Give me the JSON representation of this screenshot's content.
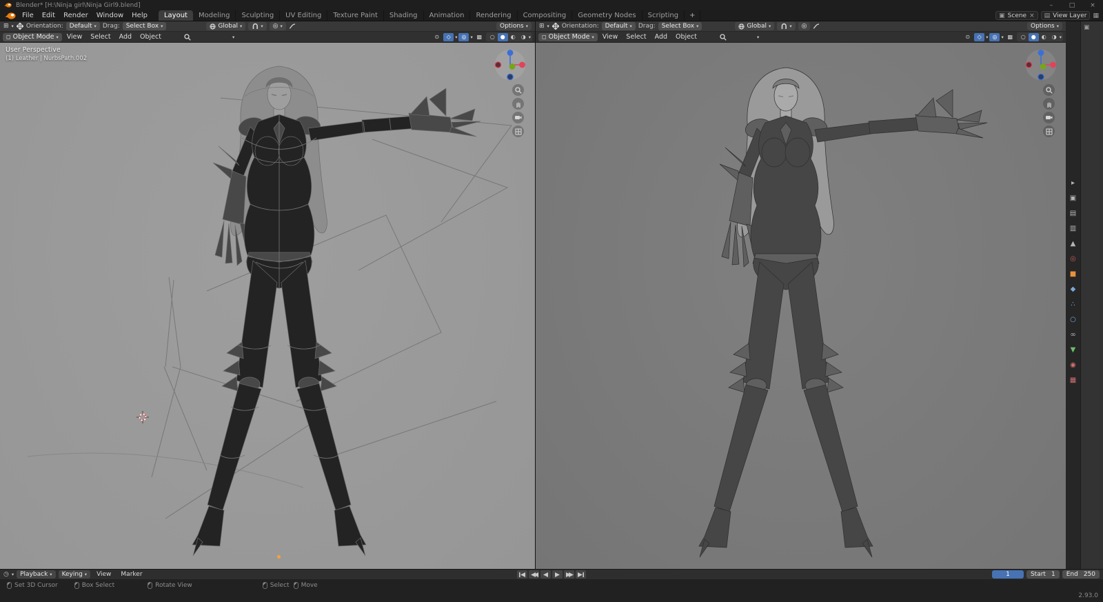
{
  "window": {
    "title": "Blender* [H:\\Ninja girl\\Ninja Girl9.blend]",
    "minimize": "–",
    "maximize": "□",
    "close": "×"
  },
  "topbar": {
    "menus": [
      "File",
      "Edit",
      "Render",
      "Window",
      "Help"
    ],
    "workspaces": [
      "Layout",
      "Modeling",
      "Sculpting",
      "UV Editing",
      "Texture Paint",
      "Shading",
      "Animation",
      "Rendering",
      "Compositing",
      "Geometry Nodes",
      "Scripting"
    ],
    "active_workspace": "Layout",
    "new_workspace": "+",
    "scene": "Scene",
    "view_layer": "View Layer"
  },
  "icons": {
    "caret": "▾",
    "close": "×",
    "visibility": "⊙",
    "gizmo": "◇",
    "overlay": "◎",
    "xray": "▩",
    "wireframe": "○",
    "solid": "●",
    "material": "◐",
    "rendered": "◑",
    "editor_3d": "⊞",
    "editor_time": "◷",
    "scene_icon": "▣",
    "view_layer_icon": "▤",
    "image_icon": "▦"
  },
  "viewport": {
    "left": {
      "tool": {
        "orientation_label": "Orientation:",
        "orientation": "Default",
        "drag_label": "Drag:",
        "drag": "Select Box",
        "transform": "Global",
        "options": "Options"
      },
      "header": {
        "mode": "Object Mode",
        "view": "View",
        "select": "Select",
        "add": "Add",
        "object": "Object"
      },
      "overlay": {
        "perspective": "User Perspective",
        "active_object": "(1) Leather | NurbsPath.002"
      }
    },
    "right": {
      "tool": {
        "orientation_label": "Orientation:",
        "orientation": "Default",
        "drag_label": "Drag:",
        "drag": "Select Box",
        "transform": "Global",
        "options": "Options"
      },
      "header": {
        "mode": "Object Mode",
        "view": "View",
        "select": "Select",
        "add": "Add",
        "object": "Object"
      }
    }
  },
  "rail": {
    "items": [
      {
        "name": "tool",
        "glyph": "▸",
        "color": "#b4b4b4"
      },
      {
        "name": "render",
        "glyph": "▣",
        "color": "#b4b4b4"
      },
      {
        "name": "output",
        "glyph": "▤",
        "color": "#b4b4b4"
      },
      {
        "name": "view-layer",
        "glyph": "▥",
        "color": "#b4b4b4"
      },
      {
        "name": "scene",
        "glyph": "▲",
        "color": "#b4b4b4"
      },
      {
        "name": "world",
        "glyph": "◎",
        "color": "#c25a5a"
      },
      {
        "name": "object",
        "glyph": "■",
        "color": "#e8923c"
      },
      {
        "name": "modifiers",
        "glyph": "◆",
        "color": "#7ba8d8"
      },
      {
        "name": "particles",
        "glyph": "∴",
        "color": "#7ba8d8"
      },
      {
        "name": "physics",
        "glyph": "○",
        "color": "#7ba8d8"
      },
      {
        "name": "constraints",
        "glyph": "∞",
        "color": "#b4b4b4"
      },
      {
        "name": "object-data",
        "glyph": "▼",
        "color": "#6cbf6c"
      },
      {
        "name": "material",
        "glyph": "◉",
        "color": "#cf6f6f"
      },
      {
        "name": "texture",
        "glyph": "▦",
        "color": "#cf6f6f"
      }
    ]
  },
  "timeline": {
    "playback": "Playback",
    "keying": "Keying",
    "view": "View",
    "marker": "Marker",
    "current_frame": "1",
    "start_label": "Start",
    "start": "1",
    "end_label": "End",
    "end": "250"
  },
  "statusbar": {
    "items": [
      "Set 3D Cursor",
      "Box Select",
      "Rotate View",
      "Select",
      "Move"
    ],
    "version": "2.93.0"
  },
  "colors": {
    "accent": "#4772b3",
    "object_orange": "#e8923c",
    "axis_x": "#e0445a",
    "axis_y": "#76a51b",
    "axis_z": "#3b6fd6",
    "viewport_left_bg": "#9a9a9a",
    "viewport_right_bg": "#7a7a7a"
  }
}
